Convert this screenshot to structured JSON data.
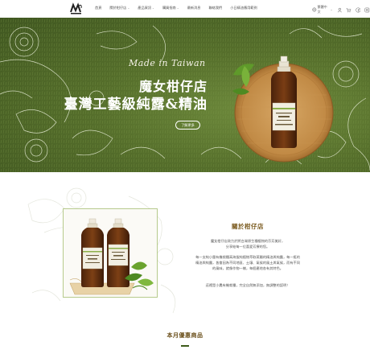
{
  "header": {
    "nav": [
      {
        "label": "首頁",
        "has_menu": false
      },
      {
        "label": "關於柑仔店",
        "has_menu": true
      },
      {
        "label": "產品資訊",
        "has_menu": true
      },
      {
        "label": "購買指南",
        "has_menu": true
      },
      {
        "label": "最新消息",
        "has_menu": false
      },
      {
        "label": "聯絡我們",
        "has_menu": false
      },
      {
        "label": "小日精油應用範例",
        "has_menu": false
      }
    ],
    "lang_label": "繁體中文",
    "icons": [
      "globe-icon",
      "user-icon",
      "cart-icon",
      "facebook-icon",
      "instagram-icon"
    ]
  },
  "hero": {
    "made_in": "Made in Taiwan",
    "line1": "魔女柑仔店",
    "line2": "臺灣工藝級純露&精油",
    "button": "了解更多",
    "bottle_label": "Made Witches'\n台灣花精\nVILLA AROMATERA"
  },
  "about": {
    "title": "關於柑仔店",
    "subtitle": "魔女柑仔店致力於將台灣原生種植物的芬芳美好，\n分享給每一位喜愛芳療的您。",
    "body": "每一支純小量有機栽種高海拔純植物萃取蒸餾的精油與純露，每一瓶的精油與純露，皆會因為不同地區、土壤、氣候的風土與氣候，而有不同的風味，就像作物一樣，每個產地各有其特色。",
    "note": "這裡是小農有機栽種，完全自然無添加，無調整的認明！"
  },
  "section_month": {
    "title": "本月優惠商品"
  },
  "colors": {
    "hero_green": "#556e2b",
    "accent_brown": "#7a5a1e",
    "frame_green": "#b6ca8c"
  }
}
